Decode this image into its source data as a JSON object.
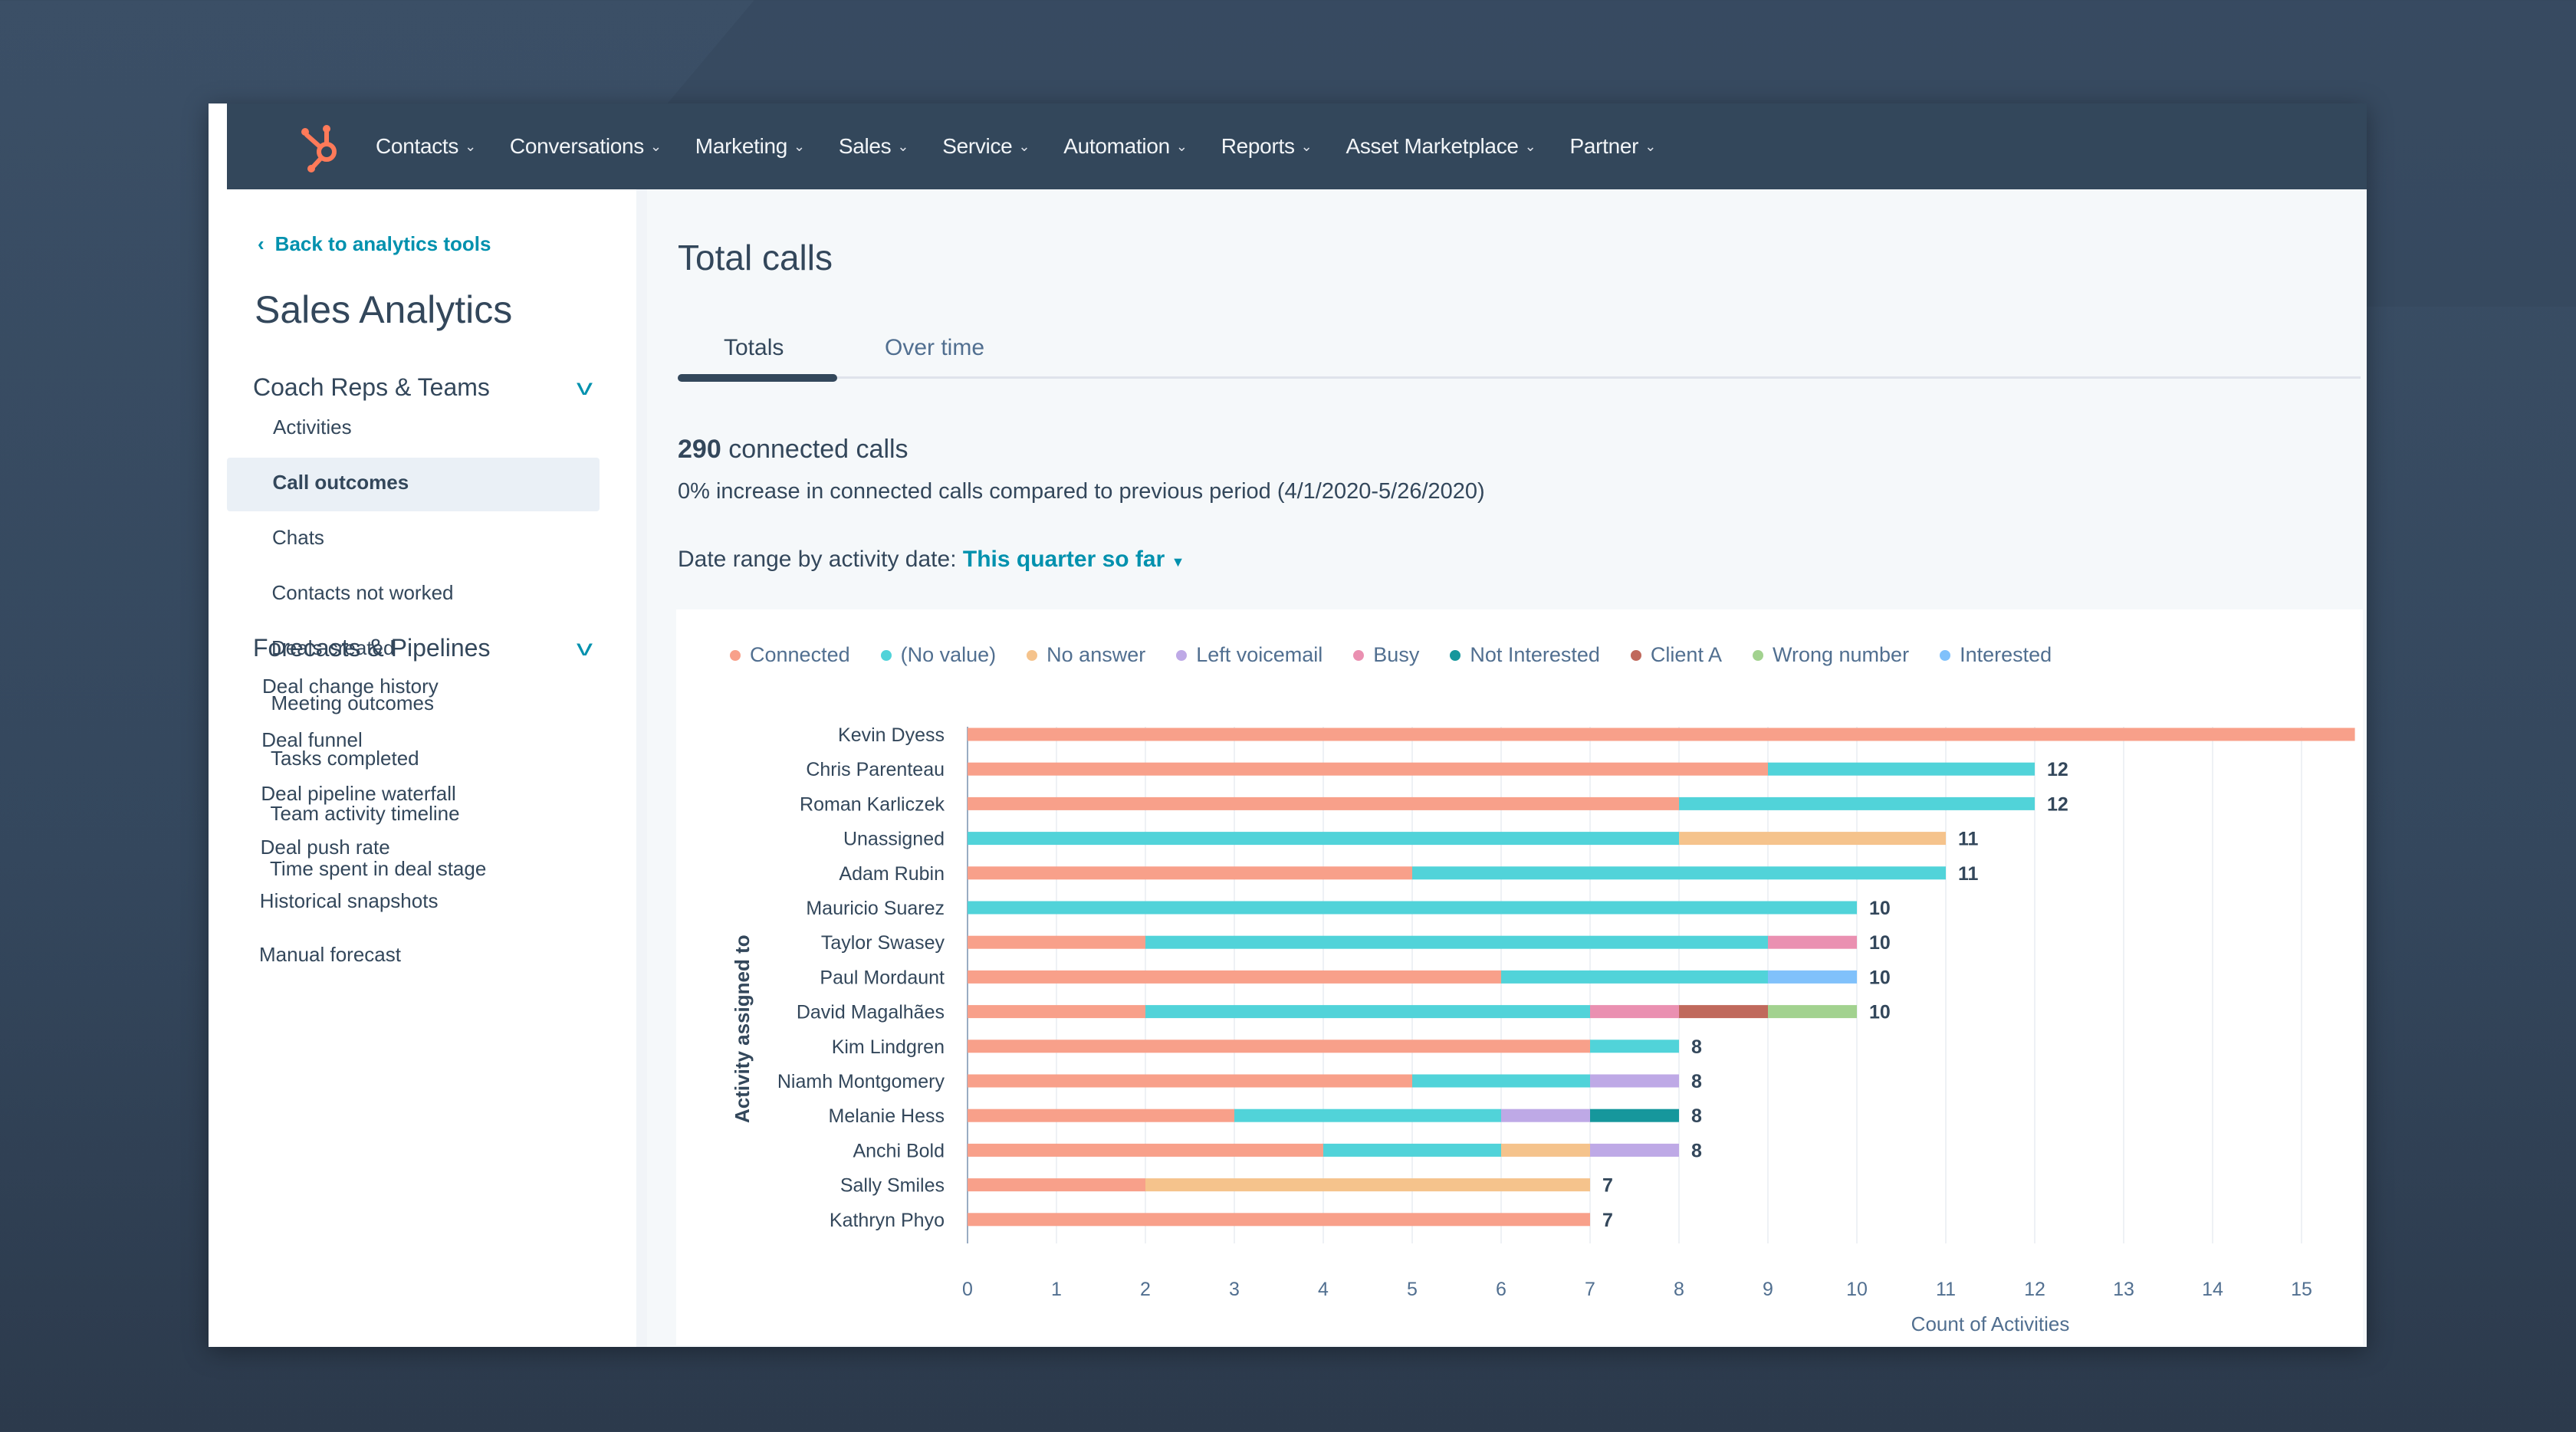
{
  "nav": {
    "logo": "hubspot-sprocket",
    "items": [
      "Contacts",
      "Conversations",
      "Marketing",
      "Sales",
      "Service",
      "Automation",
      "Reports",
      "Asset Marketplace",
      "Partner"
    ]
  },
  "sidebar": {
    "back_link": "Back to analytics tools",
    "title": "Sales Analytics",
    "sections": [
      {
        "label": "Coach Reps & Teams",
        "items": [
          "Activities",
          "Call outcomes",
          "Chats",
          "Contacts not worked",
          "Deals created",
          "Meeting outcomes",
          "Tasks completed",
          "Team activity timeline",
          "Time spent in deal stage"
        ]
      },
      {
        "label": "Forecasts & Pipelines",
        "items": [
          "Deal change history",
          "Deal funnel",
          "Deal pipeline waterfall",
          "Deal push rate",
          "Historical snapshots",
          "Manual forecast"
        ]
      }
    ],
    "active_item": "Call outcomes"
  },
  "main": {
    "title": "Total calls",
    "tabs": [
      "Totals",
      "Over time"
    ],
    "active_tab": "Totals",
    "stat_value": "290",
    "stat_label": "connected calls",
    "stat_sub": "0% increase in connected calls compared to previous period (4/1/2020-5/26/2020)",
    "date_range_label": "Date range by activity date:",
    "date_range_value": "This quarter so far"
  },
  "chart_data": {
    "type": "bar",
    "orientation": "horizontal",
    "stacked": true,
    "xlabel": "Count of Activities",
    "ylabel": "Activity assigned to",
    "xlim": [
      0,
      15
    ],
    "xticks": [
      0,
      1,
      2,
      3,
      4,
      5,
      6,
      7,
      8,
      9,
      10,
      11,
      12,
      13,
      14,
      15
    ],
    "grid": true,
    "legend_position": "top-left",
    "series": [
      {
        "name": "Connected",
        "color": "#f8a08a"
      },
      {
        "name": "(No value)",
        "color": "#51d3d9"
      },
      {
        "name": "No answer",
        "color": "#f5c38c"
      },
      {
        "name": "Left voicemail",
        "color": "#bea9e6"
      },
      {
        "name": "Busy",
        "color": "#ea90b1"
      },
      {
        "name": "Not Interested",
        "color": "#16979c"
      },
      {
        "name": "Client A",
        "color": "#c0695c"
      },
      {
        "name": "Wrong number",
        "color": "#a2d28f"
      },
      {
        "name": "Interested",
        "color": "#80c1fb"
      }
    ],
    "categories": [
      "Kevin Dyess",
      "Chris Parenteau",
      "Roman Karliczek",
      "Unassigned",
      "Adam Rubin",
      "Mauricio Suarez",
      "Taylor Swasey",
      "Paul Mordaunt",
      "David Magalhães",
      "Kim Lindgren",
      "Niamh Montgomery",
      "Melanie Hess",
      "Anchi Bold",
      "Sally Smiles",
      "Kathryn Phyo"
    ],
    "rows": [
      {
        "name": "Kevin Dyess",
        "segments": [
          {
            "series": "Connected",
            "value": 15.6
          }
        ],
        "total_label": ""
      },
      {
        "name": "Chris Parenteau",
        "segments": [
          {
            "series": "Connected",
            "value": 9
          },
          {
            "series": "(No value)",
            "value": 3
          }
        ],
        "total_label": "12"
      },
      {
        "name": "Roman Karliczek",
        "segments": [
          {
            "series": "Connected",
            "value": 8
          },
          {
            "series": "(No value)",
            "value": 4
          }
        ],
        "total_label": "12"
      },
      {
        "name": "Unassigned",
        "segments": [
          {
            "series": "(No value)",
            "value": 8
          },
          {
            "series": "No answer",
            "value": 3
          }
        ],
        "total_label": "11"
      },
      {
        "name": "Adam Rubin",
        "segments": [
          {
            "series": "Connected",
            "value": 5
          },
          {
            "series": "(No value)",
            "value": 6
          }
        ],
        "total_label": "11"
      },
      {
        "name": "Mauricio Suarez",
        "segments": [
          {
            "series": "(No value)",
            "value": 10
          }
        ],
        "total_label": "10"
      },
      {
        "name": "Taylor Swasey",
        "segments": [
          {
            "series": "Connected",
            "value": 2
          },
          {
            "series": "(No value)",
            "value": 7
          },
          {
            "series": "Busy",
            "value": 1
          }
        ],
        "total_label": "10"
      },
      {
        "name": "Paul Mordaunt",
        "segments": [
          {
            "series": "Connected",
            "value": 6
          },
          {
            "series": "(No value)",
            "value": 3
          },
          {
            "series": "Interested",
            "value": 1
          }
        ],
        "total_label": "10"
      },
      {
        "name": "David Magalhães",
        "segments": [
          {
            "series": "Connected",
            "value": 2
          },
          {
            "series": "(No value)",
            "value": 5
          },
          {
            "series": "Busy",
            "value": 1
          },
          {
            "series": "Client A",
            "value": 1
          },
          {
            "series": "Wrong number",
            "value": 1
          }
        ],
        "total_label": "10"
      },
      {
        "name": "Kim Lindgren",
        "segments": [
          {
            "series": "Connected",
            "value": 7
          },
          {
            "series": "(No value)",
            "value": 1
          }
        ],
        "total_label": "8"
      },
      {
        "name": "Niamh Montgomery",
        "segments": [
          {
            "series": "Connected",
            "value": 5
          },
          {
            "series": "(No value)",
            "value": 2
          },
          {
            "series": "Left voicemail",
            "value": 1
          }
        ],
        "total_label": "8"
      },
      {
        "name": "Melanie Hess",
        "segments": [
          {
            "series": "Connected",
            "value": 3
          },
          {
            "series": "(No value)",
            "value": 3
          },
          {
            "series": "Left voicemail",
            "value": 1
          },
          {
            "series": "Not Interested",
            "value": 1
          }
        ],
        "total_label": "8"
      },
      {
        "name": "Anchi Bold",
        "segments": [
          {
            "series": "Connected",
            "value": 4
          },
          {
            "series": "(No value)",
            "value": 2
          },
          {
            "series": "No answer",
            "value": 1
          },
          {
            "series": "Left voicemail",
            "value": 1
          }
        ],
        "total_label": "8"
      },
      {
        "name": "Sally Smiles",
        "segments": [
          {
            "series": "Connected",
            "value": 2
          },
          {
            "series": "No answer",
            "value": 5
          }
        ],
        "total_label": "7"
      },
      {
        "name": "Kathryn Phyo",
        "segments": [
          {
            "series": "Connected",
            "value": 7
          }
        ],
        "total_label": "7"
      }
    ]
  }
}
